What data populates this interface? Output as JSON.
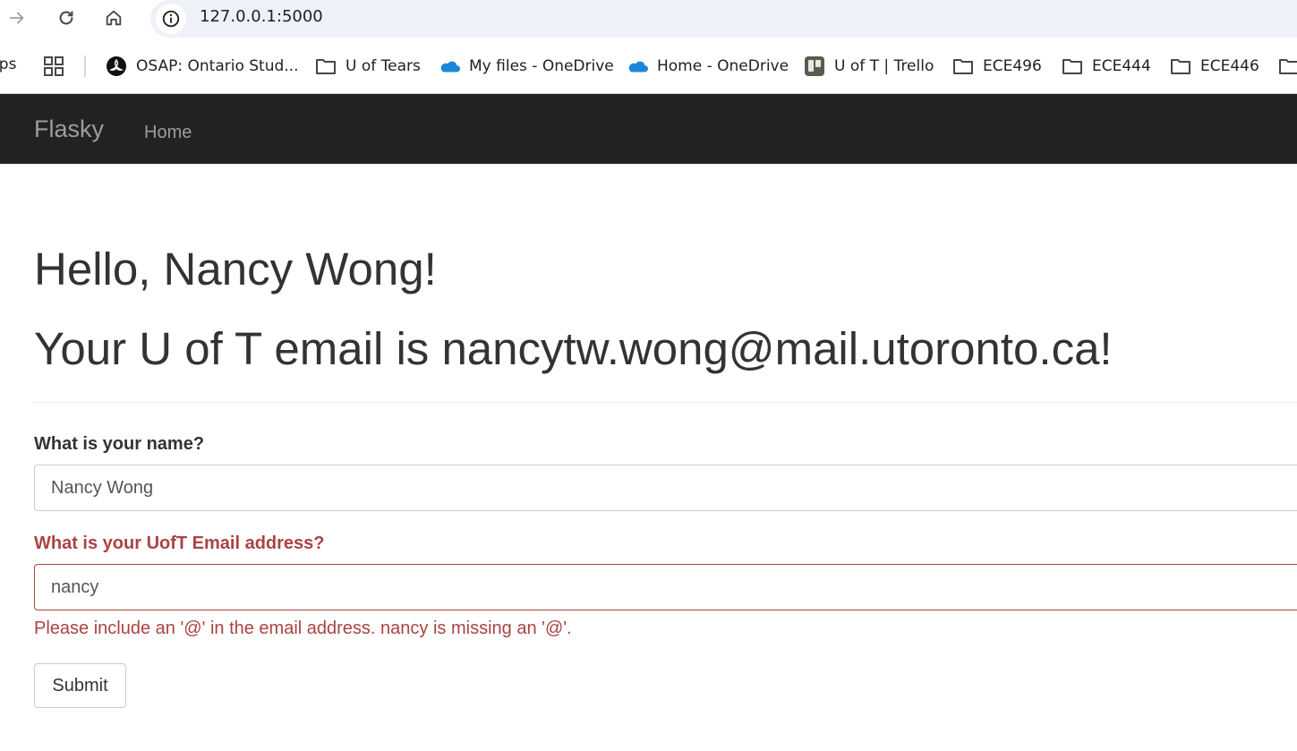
{
  "browser": {
    "url": "127.0.0.1:5000",
    "bookmarks_bar": {
      "apps_cut_label": "pps",
      "items": [
        {
          "label": "OSAP: Ontario Stud...",
          "icon": "ontario-trillium-icon"
        },
        {
          "label": "U of Tears",
          "icon": "folder-icon"
        },
        {
          "label": "My files - OneDrive",
          "icon": "onedrive-cloud-icon"
        },
        {
          "label": "Home - OneDrive",
          "icon": "onedrive-cloud-icon"
        },
        {
          "label": "U of T | Trello",
          "icon": "trello-icon"
        },
        {
          "label": "ECE496",
          "icon": "folder-icon"
        },
        {
          "label": "ECE444",
          "icon": "folder-icon"
        },
        {
          "label": "ECE446",
          "icon": "folder-icon"
        }
      ]
    }
  },
  "navbar": {
    "brand": "Flasky",
    "links": [
      {
        "label": "Home"
      }
    ]
  },
  "main": {
    "greeting": "Hello, Nancy Wong!",
    "email_line": "Your U of T email is nancytw.wong@mail.utoronto.ca!",
    "form": {
      "name_label": "What is your name?",
      "name_value": "Nancy Wong",
      "email_label": "What is your UofT Email address?",
      "email_value": "nancy",
      "email_error": "Please include an '@' in the email address. nancy is missing an '@'.",
      "submit_label": "Submit"
    }
  },
  "colors": {
    "navbar_bg": "#222222",
    "navbar_text": "#9d9d9d",
    "error": "#a94442",
    "omnibox_bg": "#eef1f8",
    "onedrive_blue": "#1e86d8"
  }
}
